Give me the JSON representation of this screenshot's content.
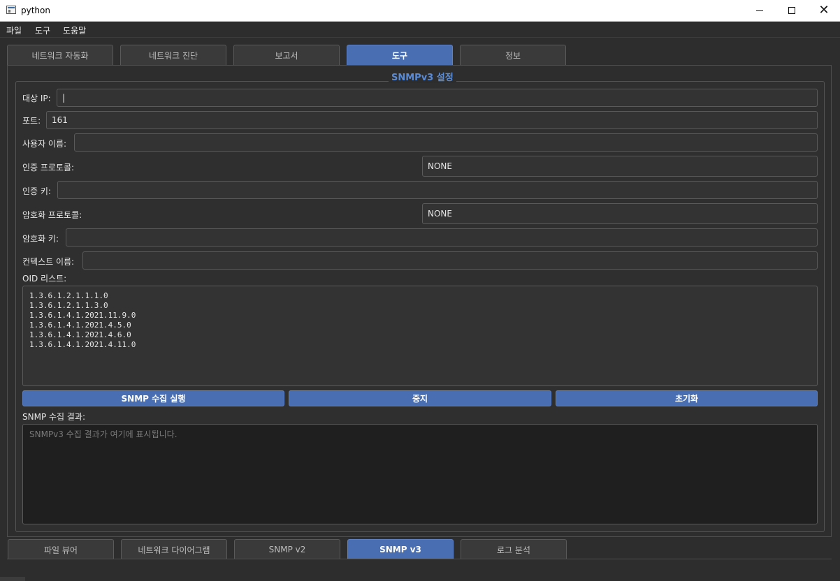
{
  "window": {
    "title": "python"
  },
  "menu": [
    "파일",
    "도구",
    "도움말"
  ],
  "top_tabs": [
    {
      "label": "네트워크 자동화",
      "active": false
    },
    {
      "label": "네트워크 진단",
      "active": false
    },
    {
      "label": "보고서",
      "active": false
    },
    {
      "label": "도구",
      "active": true
    },
    {
      "label": "정보",
      "active": false
    }
  ],
  "group_title": "SNMPv3 설정",
  "form": {
    "target_ip": {
      "label": "대상 IP:",
      "value": "|"
    },
    "port": {
      "label": "포트:",
      "value": "161"
    },
    "username": {
      "label": "사용자 이름:",
      "value": ""
    },
    "auth_protocol": {
      "label": "인증 프로토콜:",
      "value": "NONE"
    },
    "auth_key": {
      "label": "인증 키:",
      "value": ""
    },
    "priv_protocol": {
      "label": "암호화 프로토콜:",
      "value": "NONE"
    },
    "priv_key": {
      "label": "암호화 키:",
      "value": ""
    },
    "context_name": {
      "label": "컨텍스트 이름:",
      "value": ""
    },
    "oid_list": {
      "label": "OID 리스트:",
      "value": "1.3.6.1.2.1.1.1.0\n1.3.6.1.2.1.1.3.0\n1.3.6.1.4.1.2021.11.9.0\n1.3.6.1.4.1.2021.4.5.0\n1.3.6.1.4.1.2021.4.6.0\n1.3.6.1.4.1.2021.4.11.0"
    }
  },
  "buttons": {
    "run": "SNMP 수집 실행",
    "stop": "중지",
    "reset": "초기화"
  },
  "result": {
    "label": "SNMP 수집 결과:",
    "placeholder": "SNMPv3 수집 결과가 여기에 표시됩니다."
  },
  "bottom_tabs": [
    {
      "label": "파일 뷰어",
      "active": false
    },
    {
      "label": "네트워크 다이어그램",
      "active": false
    },
    {
      "label": "SNMP v2",
      "active": false
    },
    {
      "label": "SNMP v3",
      "active": true
    },
    {
      "label": "로그 분석",
      "active": false
    }
  ],
  "colors": {
    "accent": "#4a6eb2",
    "background": "#2d2d2d",
    "title_accent": "#5a8bd6"
  }
}
